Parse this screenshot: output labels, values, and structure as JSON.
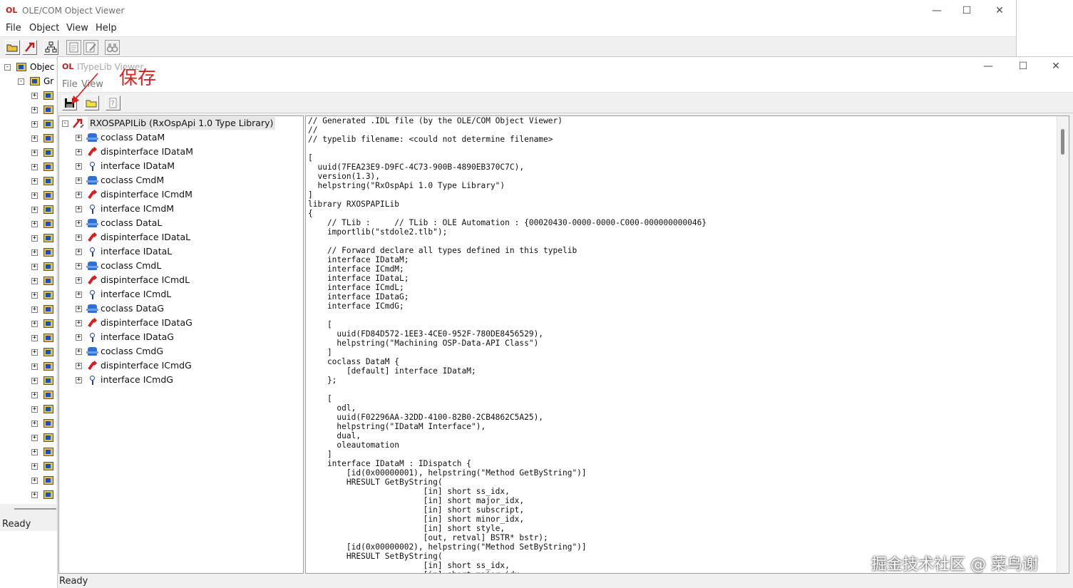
{
  "ole_window": {
    "title": "OLE/COM Object Viewer",
    "menu": [
      "File",
      "Object",
      "View",
      "Help"
    ],
    "tree_root": "Objec",
    "tree_group": "Gr",
    "status": "Ready"
  },
  "typelib_window": {
    "title": "ITypeLib Viewer",
    "menu": [
      "File",
      "View"
    ],
    "tree": {
      "root": "RXOSPAPILib (RxOspApi 1.0 Type Library)",
      "items": [
        {
          "kind": "coclass",
          "label": "coclass DataM"
        },
        {
          "kind": "dispinterface",
          "label": "dispinterface IDataM"
        },
        {
          "kind": "interface",
          "label": "interface IDataM"
        },
        {
          "kind": "coclass",
          "label": "coclass CmdM"
        },
        {
          "kind": "dispinterface",
          "label": "dispinterface ICmdM"
        },
        {
          "kind": "interface",
          "label": "interface ICmdM"
        },
        {
          "kind": "coclass",
          "label": "coclass DataL"
        },
        {
          "kind": "dispinterface",
          "label": "dispinterface IDataL"
        },
        {
          "kind": "interface",
          "label": "interface IDataL"
        },
        {
          "kind": "coclass",
          "label": "coclass CmdL"
        },
        {
          "kind": "dispinterface",
          "label": "dispinterface ICmdL"
        },
        {
          "kind": "interface",
          "label": "interface ICmdL"
        },
        {
          "kind": "coclass",
          "label": "coclass DataG"
        },
        {
          "kind": "dispinterface",
          "label": "dispinterface IDataG"
        },
        {
          "kind": "interface",
          "label": "interface IDataG"
        },
        {
          "kind": "coclass",
          "label": "coclass CmdG"
        },
        {
          "kind": "dispinterface",
          "label": "dispinterface ICmdG"
        },
        {
          "kind": "interface",
          "label": "interface ICmdG"
        }
      ]
    },
    "idl_lines": [
      "// Generated .IDL file (by the OLE/COM Object Viewer)",
      "//",
      "// typelib filename: <could not determine filename>",
      "",
      "[",
      "  uuid(7FEA23E9-D9FC-4C73-900B-4890EB370C7C),",
      "  version(1.3),",
      "  helpstring(\"RxOspApi 1.0 Type Library\")",
      "]",
      "library RXOSPAPILib",
      "{",
      "    // TLib :     // TLib : OLE Automation : {00020430-0000-0000-C000-000000000046}",
      "    importlib(\"stdole2.tlb\");",
      "",
      "    // Forward declare all types defined in this typelib",
      "    interface IDataM;",
      "    interface ICmdM;",
      "    interface IDataL;",
      "    interface ICmdL;",
      "    interface IDataG;",
      "    interface ICmdG;",
      "",
      "    [",
      "      uuid(FD84D572-1EE3-4CE0-952F-780DE8456529),",
      "      helpstring(\"Machining OSP-Data-API Class\")",
      "    ]",
      "    coclass DataM {",
      "        [default] interface IDataM;",
      "    };",
      "",
      "    [",
      "      odl,",
      "      uuid(F02296AA-32DD-4100-82B0-2CB4862C5A25),",
      "      helpstring(\"IDataM Interface\"),",
      "      dual,",
      "      oleautomation",
      "    ]",
      "    interface IDataM : IDispatch {",
      "        [id(0x00000001), helpstring(\"Method GetByString\")]",
      "        HRESULT GetByString(",
      "                        [in] short ss_idx,",
      "                        [in] short major_idx,",
      "                        [in] short subscript,",
      "                        [in] short minor_idx,",
      "                        [in] short style,",
      "                        [out, retval] BSTR* bstr);",
      "        [id(0x00000002), helpstring(\"Method SetByString\")]",
      "        HRESULT SetByString(",
      "                        [in] short ss_idx,",
      "                        [in] short major_idx,"
    ],
    "status": "Ready"
  },
  "annotation": {
    "text": "保存",
    "color": "#e01f1f"
  },
  "watermark": "掘金技术社区 @ 菜鸟谢"
}
